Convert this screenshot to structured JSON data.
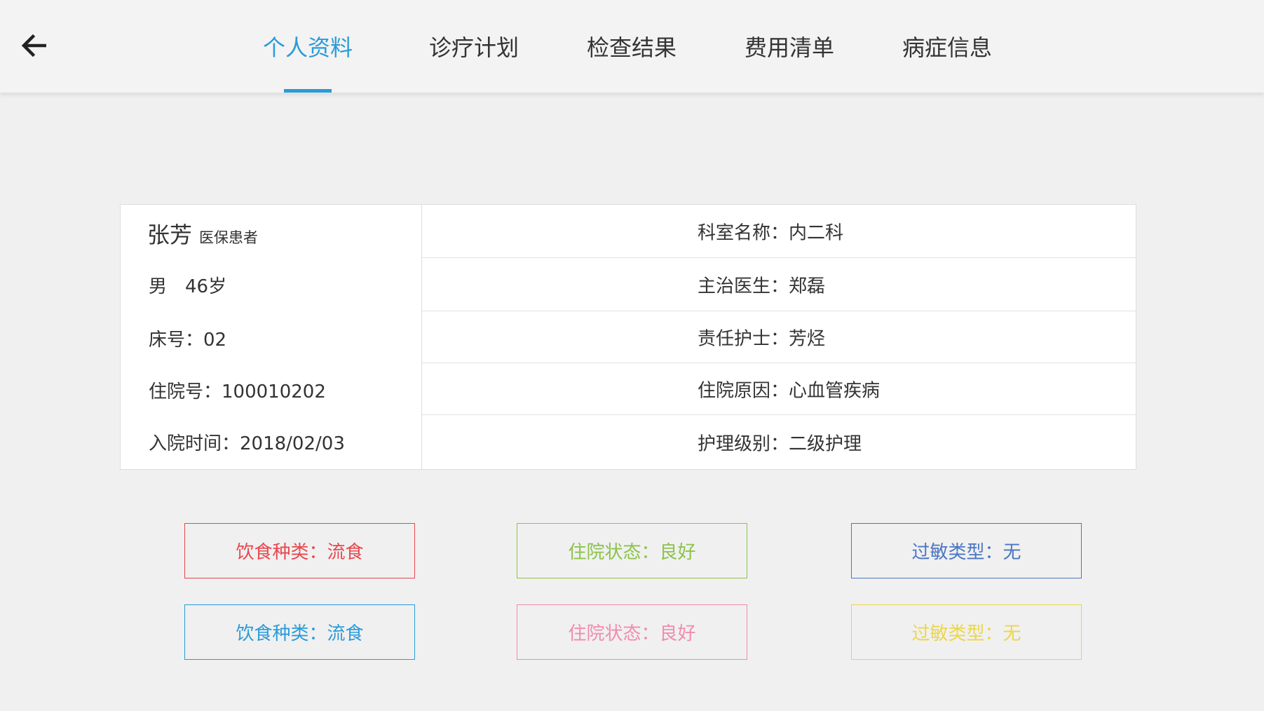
{
  "header": {
    "tabs": [
      {
        "label": "个人资料",
        "active": true
      },
      {
        "label": "诊疗计划",
        "active": false
      },
      {
        "label": "检查结果",
        "active": false
      },
      {
        "label": "费用清单",
        "active": false
      },
      {
        "label": "病症信息",
        "active": false
      }
    ],
    "back_icon": "arrow-left-icon",
    "accent_color": "#2a9bd8"
  },
  "patient": {
    "name": "张芳",
    "tag": "医保患者",
    "gender_age": "男　46岁",
    "bed": "床号：02",
    "admission_no": "住院号：100010202",
    "admission_time": "入院时间：2018/02/03"
  },
  "details": {
    "department": "科室名称：内二科",
    "doctor": "主治医生：郑磊",
    "nurse": "责任护士：芳烃",
    "reason": "住院原因：心血管疾病",
    "care_level": "护理级别：二级护理"
  },
  "status_boxes": [
    {
      "label": "饮食种类：流食",
      "color": "#e8474f"
    },
    {
      "label": "住院状态：良好",
      "color": "#8bc34a"
    },
    {
      "label": "过敏类型：无",
      "color": "#4a76c4"
    },
    {
      "label": "饮食种类：流食",
      "color": "#2a9bd8"
    },
    {
      "label": "住院状态：良好",
      "color": "#f08cb0"
    },
    {
      "label": "过敏类型：无",
      "color": "#ecd64a"
    }
  ]
}
